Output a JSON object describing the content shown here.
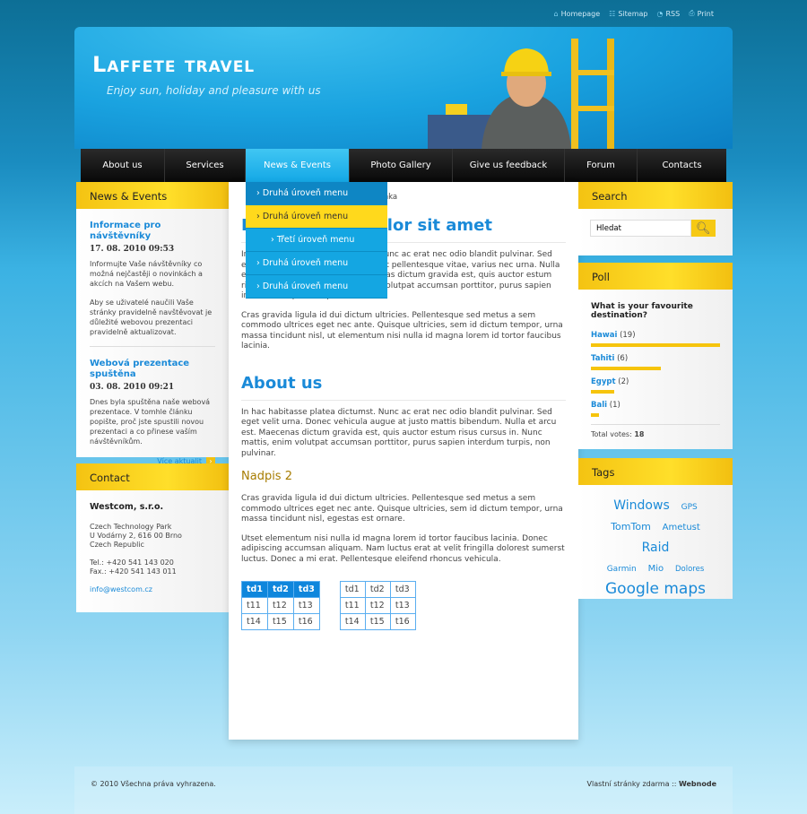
{
  "toplinks": [
    {
      "icon": "home-icon",
      "label": "Homepage"
    },
    {
      "icon": "sitemap-icon",
      "label": "Sitemap"
    },
    {
      "icon": "rss-icon",
      "label": "RSS"
    },
    {
      "icon": "print-icon",
      "label": "Print"
    }
  ],
  "header": {
    "title": "Laffete travel",
    "slogan": "Enjoy sun, holiday and pleasure with us"
  },
  "nav": [
    "About us",
    "Services",
    "News & Events",
    "Photo Gallery",
    "Give us feedback",
    "Forum",
    "Contacts"
  ],
  "dropdown": [
    "Druhá úroveň menu",
    "Druhá úroveň menu",
    "Třetí úroveň menu",
    "Druhá úroveň menu",
    "Druhá úroveň menu"
  ],
  "news": {
    "title": "News & Events",
    "items": [
      {
        "title": "Informace pro návštěvníky",
        "date": "17. 08. 2010 09:53",
        "p1": "Informujte Vaše návštěvníky co možná nejčastěji o novinkách a akcích na Vašem webu.",
        "p2": "Aby se uživatelé naučili Vaše stránky pravidelně navštěvovat je důležité webovou prezentaci pravidelně aktualizovat."
      },
      {
        "title": "Webová prezentace spuštěna",
        "date": "03. 08. 2010 09:21",
        "p1": "Dnes byla spuštěna naše webová prezentace. V tomhle článku popište, proč jste spustili novou prezentaci a co přinese vaším návštěvníkům."
      }
    ],
    "more": "Více aktualit"
  },
  "contact": {
    "title": "Contact",
    "company": "Westcom, s.r.o.",
    "address": [
      "Czech Technology Park",
      "U Vodárny 2, 616 00 Brno",
      "Czech Republic"
    ],
    "tel": "Tel.: +420 541 143 020",
    "fax": "Fax.: +420 541 143 011",
    "email": "info@westcom.cz"
  },
  "main": {
    "breadcrumb": "ránka",
    "h1": "Lorem ipsum dolor sit amet",
    "p1": "In hac habitasse platea dictumst. Nunc ac erat nec odio blandit pulvinar. Sed eget velit urna. Donec molestie eget pellentesque vitae, varius nec urna. Nulla et arcu est odkaz při najetí. Maecenas dictum gravida est, quis auctor estum risus cursus in. Nunc mattis, enim volutpat accumsan porttitor, purus sapien interdum turpis, non pulvinar.",
    "p2": "Cras gravida ligula id dui dictum ultricies. Pellentesque sed metus a sem commodo ultrices eget nec ante. Quisque ultricies, sem id dictum tempor, urna massa tincidunt nisl, ut elementum nisi nulla id magna lorem id tortor faucibus lacinia.",
    "h1b": "About us",
    "p3": "In hac habitasse platea dictumst. Nunc ac erat nec odio blandit pulvinar. Sed eget velit urna. Donec vehicula augue at justo mattis bibendum. Nulla et arcu est. Maecenas dictum gravida est, quis auctor estum risus cursus in. Nunc mattis, enim volutpat accumsan porttitor, purus sapien interdum turpis, non pulvinar.",
    "h2": "Nadpis 2",
    "p4": "Cras gravida ligula id dui dictum ultricies. Pellentesque sed metus a sem commodo ultrices eget nec ante. Quisque ultricies, sem id dictum tempor, urna massa tincidunt nisl, egestas est ornare.",
    "p5": "Utset elementum nisi nulla id magna lorem id tortor faucibus lacinia. Donec adipiscing accumsan aliquam. Nam luctus erat at velit fringilla dolorest sumerst luctus. Donec a mi erat. Pellentesque eleifend rhoncus vehicula.",
    "table": [
      [
        "td1",
        "td2",
        "td3"
      ],
      [
        "t11",
        "t12",
        "t13"
      ],
      [
        "t14",
        "t15",
        "t16"
      ]
    ]
  },
  "search": {
    "title": "Search",
    "placeholder": "Hledat"
  },
  "poll": {
    "title": "Poll",
    "question": "What is your favourite destination?",
    "options": [
      {
        "label": "Hawai",
        "count": "(19)",
        "fraction": 1.0
      },
      {
        "label": "Tahiti",
        "count": "(6)",
        "fraction": 0.54
      },
      {
        "label": "Egypt",
        "count": "(2)",
        "fraction": 0.18
      },
      {
        "label": "Bali",
        "count": "(1)",
        "fraction": 0.06
      }
    ],
    "total_label": "Total votes:",
    "total": "18"
  },
  "tags": {
    "title": "Tags",
    "items": [
      {
        "label": "Windows",
        "size": 14
      },
      {
        "label": "GPS",
        "size": 9
      },
      {
        "label": "TomTom",
        "size": 11
      },
      {
        "label": "Ametust",
        "size": 10
      },
      {
        "label": "Raid",
        "size": 14
      },
      {
        "label": "Garmin",
        "size": 9
      },
      {
        "label": "Mio",
        "size": 10
      },
      {
        "label": "Dolores",
        "size": 8.5
      },
      {
        "label": "Google maps",
        "size": 17
      }
    ]
  },
  "footer": {
    "copyright": "© 2010 Všechna práva vyhrazena.",
    "link": "Vlastní stránky zdarma :: ",
    "brand": "Webnode"
  },
  "colors": {
    "accent_blue": "#1a8ad8",
    "yellow": "#f6c914",
    "nav_dark": "#0a0a0a"
  }
}
